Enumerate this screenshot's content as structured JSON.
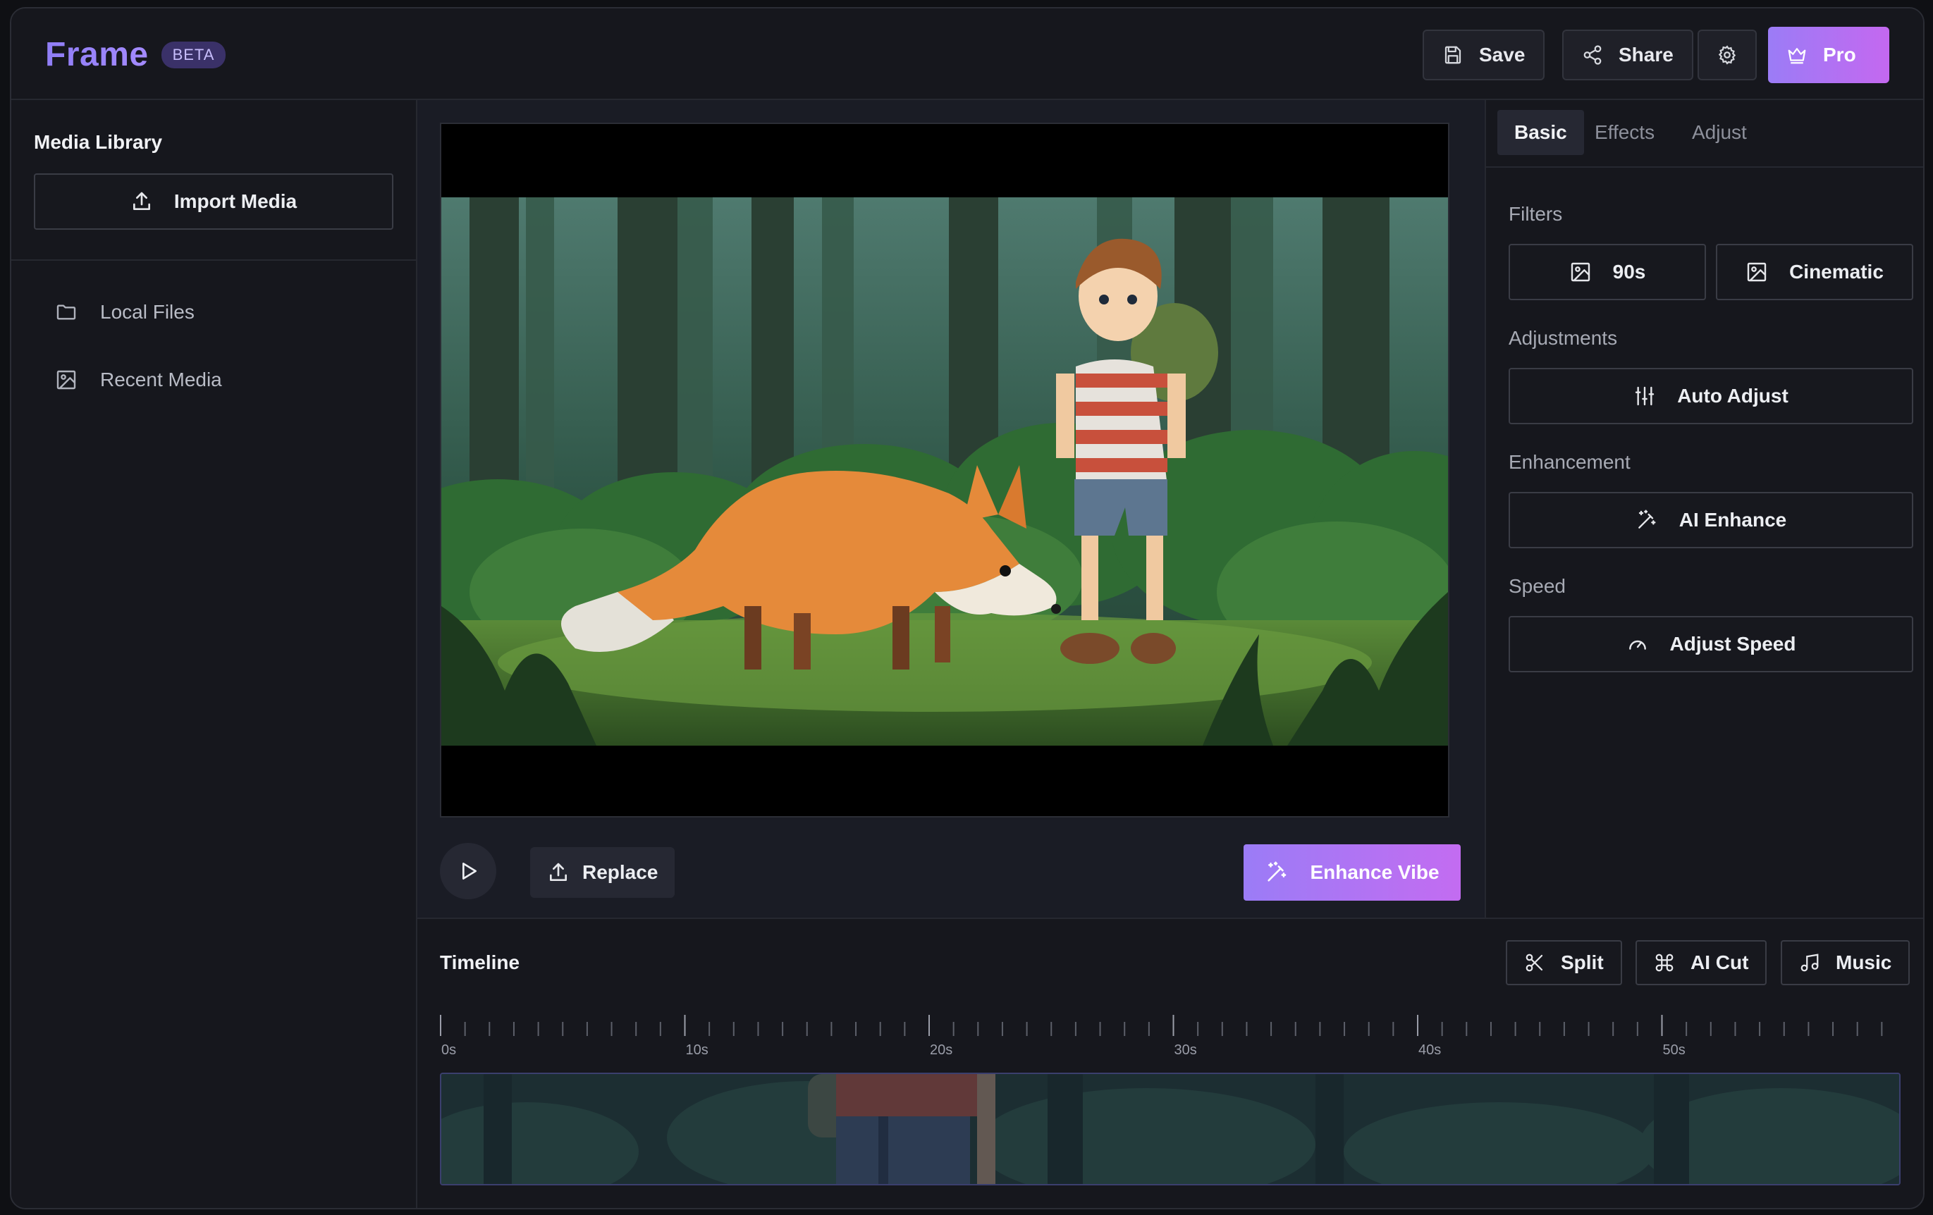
{
  "header": {
    "brand": "Frame",
    "badge": "BETA",
    "save_label": "Save",
    "share_label": "Share",
    "pro_label": "Pro"
  },
  "sidebar": {
    "title": "Media Library",
    "import_label": "Import Media",
    "items": [
      {
        "label": "Local Files",
        "icon": "folder-icon"
      },
      {
        "label": "Recent Media",
        "icon": "image-icon"
      }
    ]
  },
  "preview": {
    "replace_label": "Replace",
    "enhance_label": "Enhance Vibe"
  },
  "panel": {
    "tabs": [
      {
        "label": "Basic",
        "active": true
      },
      {
        "label": "Effects",
        "active": false
      },
      {
        "label": "Adjust",
        "active": false
      }
    ],
    "filters_label": "Filters",
    "filters": [
      "90s",
      "Cinematic"
    ],
    "adjustments_label": "Adjustments",
    "auto_adjust_label": "Auto Adjust",
    "enhancement_label": "Enhancement",
    "ai_enhance_label": "AI Enhance",
    "speed_label": "Speed",
    "adjust_speed_label": "Adjust Speed"
  },
  "timeline": {
    "title": "Timeline",
    "split_label": "Split",
    "ai_cut_label": "AI Cut",
    "music_label": "Music",
    "ticks": [
      "0s",
      "10s",
      "20s",
      "30s",
      "40s",
      "50s"
    ]
  },
  "colors": {
    "accent_start": "#9b7cf6",
    "accent_end": "#c468f0",
    "background": "#16171d"
  }
}
